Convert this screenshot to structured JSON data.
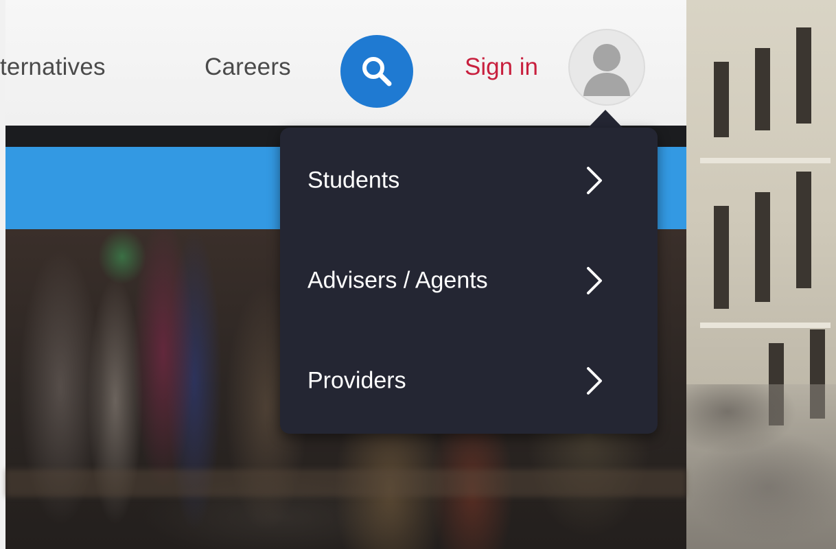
{
  "nav": {
    "alternatives_label": "lternatives",
    "careers_label": "Careers",
    "search_icon": "search-icon",
    "signin_label": "Sign in",
    "avatar_icon": "user-avatar-icon"
  },
  "dropdown": {
    "items": [
      {
        "label": "Students",
        "icon": "chevron-right-icon"
      },
      {
        "label": "Advisers / Agents",
        "icon": "chevron-right-icon"
      },
      {
        "label": "Providers",
        "icon": "chevron-right-icon"
      }
    ]
  },
  "colors": {
    "search_button": "#1f7ad2",
    "signin_text": "#c8203e",
    "blue_band": "#3399e3",
    "dropdown_bg": "#242633"
  }
}
